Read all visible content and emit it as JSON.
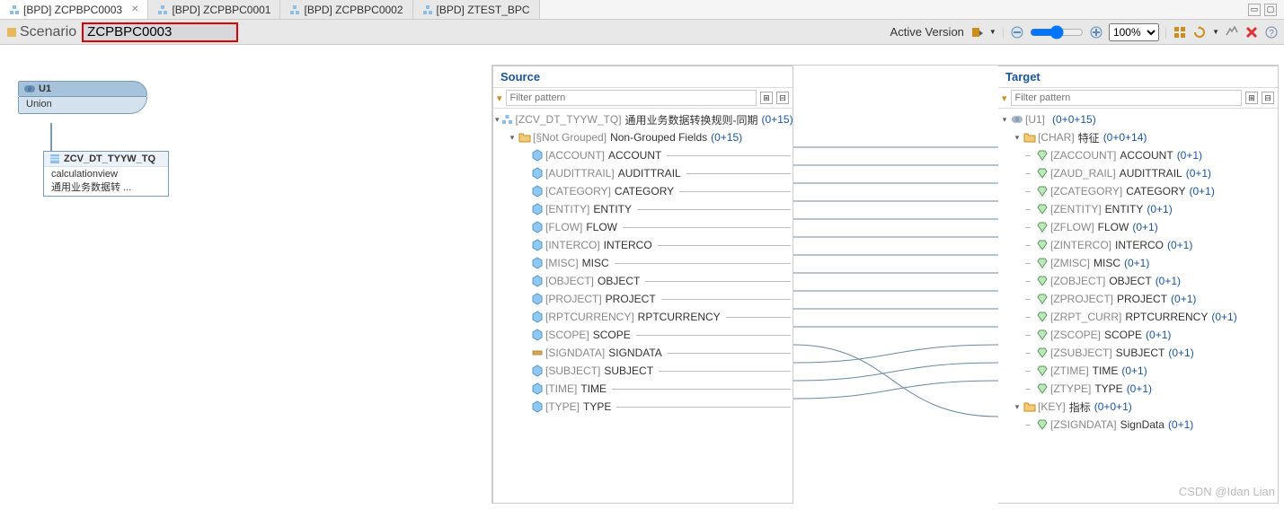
{
  "tabs": [
    {
      "label": "[BPD] ZCPBPC0003",
      "active": true,
      "closable": true
    },
    {
      "label": "[BPD] ZCPBPC0001",
      "active": false,
      "closable": false
    },
    {
      "label": "[BPD] ZCPBPC0002",
      "active": false,
      "closable": false
    },
    {
      "label": "[BPD] ZTEST_BPC",
      "active": false,
      "closable": false
    }
  ],
  "toolbar": {
    "scenario_label": "Scenario",
    "scenario_value": "ZCPBPC0003",
    "active_version": "Active Version",
    "zoom": "100%"
  },
  "diagram": {
    "u1": {
      "title": "U1",
      "body": "Union"
    },
    "cv": {
      "title": "ZCV_DT_TYYW_TQ",
      "line1": "calculationview",
      "line2": "通用业务数据转 ..."
    }
  },
  "source": {
    "title": "Source",
    "filter_placeholder": "Filter pattern",
    "root": {
      "tech": "[ZCV_DT_TYYW_TQ]",
      "name": "通用业务数据转换规则-同期",
      "count": "(0+15)"
    },
    "group": {
      "tech": "[§Not Grouped]",
      "name": "Non-Grouped Fields",
      "count": "(0+15)"
    },
    "fields": [
      {
        "tech": "[ACCOUNT]",
        "name": "ACCOUNT",
        "icon": "attr"
      },
      {
        "tech": "[AUDITTRAIL]",
        "name": "AUDITTRAIL",
        "icon": "attr"
      },
      {
        "tech": "[CATEGORY]",
        "name": "CATEGORY",
        "icon": "attr"
      },
      {
        "tech": "[ENTITY]",
        "name": "ENTITY",
        "icon": "attr"
      },
      {
        "tech": "[FLOW]",
        "name": "FLOW",
        "icon": "attr"
      },
      {
        "tech": "[INTERCO]",
        "name": "INTERCO",
        "icon": "attr"
      },
      {
        "tech": "[MISC]",
        "name": "MISC",
        "icon": "attr"
      },
      {
        "tech": "[OBJECT]",
        "name": "OBJECT",
        "icon": "attr"
      },
      {
        "tech": "[PROJECT]",
        "name": "PROJECT",
        "icon": "attr"
      },
      {
        "tech": "[RPTCURRENCY]",
        "name": "RPTCURRENCY",
        "icon": "attr"
      },
      {
        "tech": "[SCOPE]",
        "name": "SCOPE",
        "icon": "attr"
      },
      {
        "tech": "[SIGNDATA]",
        "name": "SIGNDATA",
        "icon": "measure"
      },
      {
        "tech": "[SUBJECT]",
        "name": "SUBJECT",
        "icon": "attr"
      },
      {
        "tech": "[TIME]",
        "name": "TIME",
        "icon": "attr"
      },
      {
        "tech": "[TYPE]",
        "name": "TYPE",
        "icon": "attr"
      }
    ]
  },
  "target": {
    "title": "Target",
    "filter_placeholder": "Filter pattern",
    "root": {
      "tech": "[U1]",
      "count": "(0+0+15)"
    },
    "char_group": {
      "tech": "[CHAR]",
      "name": "特征",
      "count": "(0+0+14)"
    },
    "fields": [
      {
        "tech": "[ZACCOUNT]",
        "name": "ACCOUNT",
        "count": "(0+1)"
      },
      {
        "tech": "[ZAUD_RAIL]",
        "name": "AUDITTRAIL",
        "count": "(0+1)"
      },
      {
        "tech": "[ZCATEGORY]",
        "name": "CATEGORY",
        "count": "(0+1)"
      },
      {
        "tech": "[ZENTITY]",
        "name": "ENTITY",
        "count": "(0+1)"
      },
      {
        "tech": "[ZFLOW]",
        "name": "FLOW",
        "count": "(0+1)"
      },
      {
        "tech": "[ZINTERCO]",
        "name": "INTERCO",
        "count": "(0+1)"
      },
      {
        "tech": "[ZMISC]",
        "name": "MISC",
        "count": "(0+1)"
      },
      {
        "tech": "[ZOBJECT]",
        "name": "OBJECT",
        "count": "(0+1)"
      },
      {
        "tech": "[ZPROJECT]",
        "name": "PROJECT",
        "count": "(0+1)"
      },
      {
        "tech": "[ZRPT_CURR]",
        "name": "RPTCURRENCY",
        "count": "(0+1)"
      },
      {
        "tech": "[ZSCOPE]",
        "name": "SCOPE",
        "count": "(0+1)"
      },
      {
        "tech": "[ZSUBJECT]",
        "name": "SUBJECT",
        "count": "(0+1)"
      },
      {
        "tech": "[ZTIME]",
        "name": "TIME",
        "count": "(0+1)"
      },
      {
        "tech": "[ZTYPE]",
        "name": "TYPE",
        "count": "(0+1)"
      }
    ],
    "key_group": {
      "tech": "[KEY]",
      "name": "指标",
      "count": "(0+0+1)"
    },
    "key_fields": [
      {
        "tech": "[ZSIGNDATA]",
        "name": "SignData",
        "count": "(0+1)"
      }
    ]
  },
  "watermark": "CSDN @Idan Lian"
}
